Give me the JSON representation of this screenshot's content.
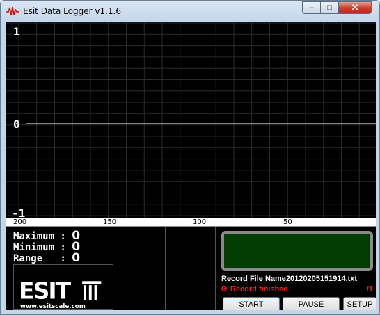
{
  "window": {
    "title": "Esit Data Logger v1.1.6",
    "controls": {
      "minimize": "–",
      "maximize": "□",
      "close": "✕"
    }
  },
  "plot": {
    "y_labels": {
      "top": "1",
      "mid": "0",
      "bottom": "-1"
    },
    "x_labels": [
      "200",
      "150",
      "100",
      "50"
    ]
  },
  "stats": {
    "max_label": "Maximum : ",
    "max_value": "0",
    "min_label": "Minimum : ",
    "min_value": "0",
    "range_label": "Range   : ",
    "range_value": "0"
  },
  "logo": {
    "brand": "ESIT",
    "url": "www.esitscale.com"
  },
  "record": {
    "file_label": "Record File Name20120205151914.txt",
    "status": "Record finished",
    "count": "/1"
  },
  "buttons": {
    "start": "START",
    "pause": "PAUSE",
    "setup": "SETUP"
  },
  "colors": {
    "status_red": "#ff1a1a",
    "lcd_green": "#013d03",
    "trace": "#ffffff"
  }
}
